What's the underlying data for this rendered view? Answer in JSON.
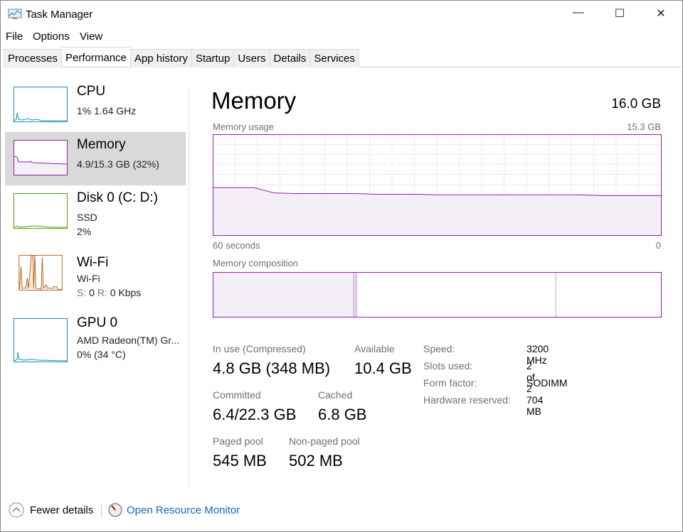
{
  "window": {
    "title": "Task Manager",
    "minimize": "—",
    "maximize": "☐",
    "close": "✕"
  },
  "menu": [
    "File",
    "Options",
    "View"
  ],
  "tabs": [
    "Processes",
    "Performance",
    "App history",
    "Startup",
    "Users",
    "Details",
    "Services"
  ],
  "active_tab": "Performance",
  "sidebar": [
    {
      "name": "CPU",
      "sub1": "1% 1.64 GHz",
      "color": "#1a8fc6"
    },
    {
      "name": "Memory",
      "sub1": "4.9/15.3 GB (32%)",
      "color": "#8b22a9",
      "selected": true
    },
    {
      "name": "Disk 0 (C: D:)",
      "sub1": "SSD",
      "sub2": "2%",
      "color": "#4da60c"
    },
    {
      "name": "Wi-Fi",
      "sub1": "Wi-Fi",
      "s_label": "S:",
      "s_value": "0",
      "r_label": "R:",
      "r_value": "0 Kbps",
      "color": "#a74f01"
    },
    {
      "name": "GPU 0",
      "sub1": "AMD Radeon(TM) Gr...",
      "sub2": "0% (34 °C)",
      "color": "#1a8fc6"
    }
  ],
  "main": {
    "title": "Memory",
    "total": "16.0 GB",
    "usage_label": "Memory usage",
    "usage_max": "15.3 GB",
    "time_left": "60 seconds",
    "time_right": "0",
    "composition_label": "Memory composition",
    "composition": {
      "in_use_gb": 4.8,
      "modified_gb": 0.1,
      "standby_gb": 6.8,
      "free_gb": 3.6
    },
    "usage_series_gb": [
      7.2,
      7.2,
      7.2,
      6.4,
      6.3,
      6.3,
      6.3,
      6.3,
      6.2,
      6.2,
      6.2,
      6.1,
      6.1,
      6.1,
      6.1,
      6.1,
      6.1,
      6.1,
      6.1,
      6.0,
      6.0,
      6.0,
      6.0
    ],
    "stats": {
      "in_use_label": "In use (Compressed)",
      "in_use": "4.8 GB (348 MB)",
      "available_label": "Available",
      "available": "10.4 GB",
      "committed_label": "Committed",
      "committed": "6.4/22.3 GB",
      "cached_label": "Cached",
      "cached": "6.8 GB",
      "paged_label": "Paged pool",
      "paged": "545 MB",
      "nonpaged_label": "Non-paged pool",
      "nonpaged": "502 MB"
    },
    "specs": [
      {
        "label": "Speed:",
        "value": "3200 MHz"
      },
      {
        "label": "Slots used:",
        "value": "2 of 2"
      },
      {
        "label": "Form factor:",
        "value": "SODIMM"
      },
      {
        "label": "Hardware reserved:",
        "value": "704 MB"
      }
    ]
  },
  "footer": {
    "fewer_details": "Fewer details",
    "open_monitor": "Open Resource Monitor"
  }
}
